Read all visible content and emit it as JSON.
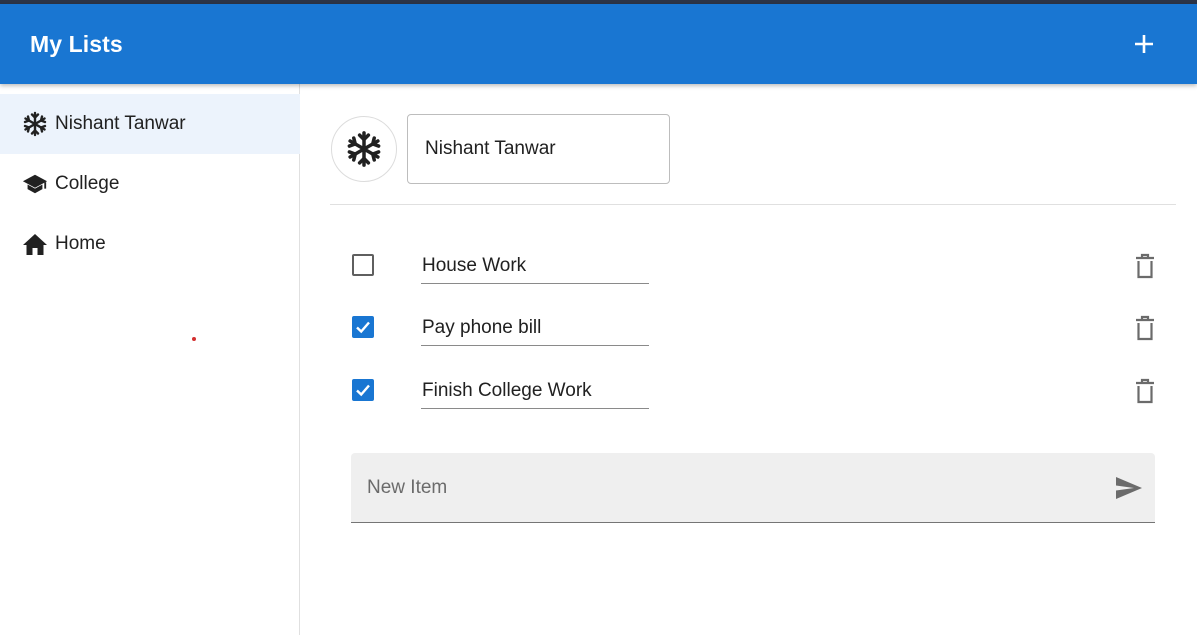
{
  "app": {
    "title": "My Lists"
  },
  "toolbar": {
    "add_icon": "plus-icon"
  },
  "sidebar": {
    "items": [
      {
        "label": "Nishant Tanwar",
        "icon": "snowflake-icon",
        "active": true
      },
      {
        "label": "College",
        "icon": "school-icon",
        "active": false
      },
      {
        "label": "Home",
        "icon": "home-icon",
        "active": false
      }
    ]
  },
  "list": {
    "name": "Nishant Tanwar",
    "icon": "snowflake-icon",
    "items": [
      {
        "text": "House Work",
        "checked": false
      },
      {
        "text": "Pay phone bill",
        "checked": true
      },
      {
        "text": "Finish College Work",
        "checked": true
      }
    ],
    "new_item_placeholder": "New Item"
  },
  "colors": {
    "primary": "#1976d2",
    "active_nav": "#ecf3fc"
  }
}
